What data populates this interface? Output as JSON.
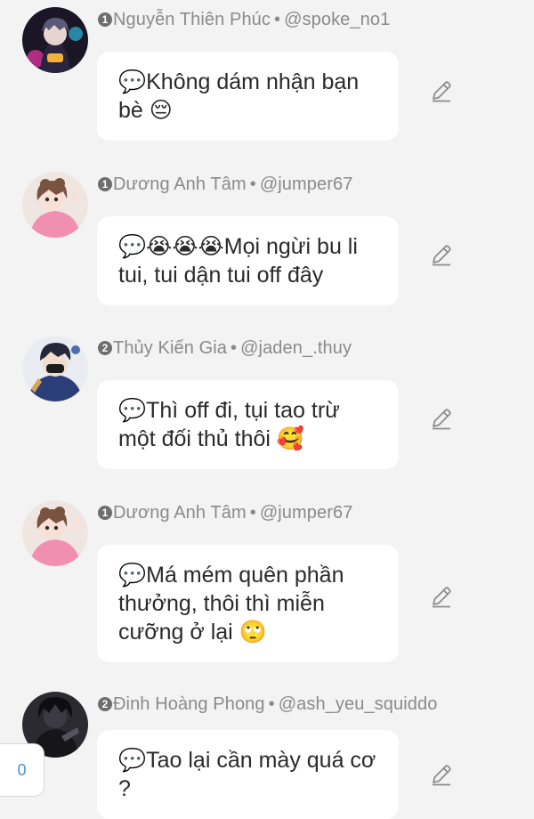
{
  "comments": [
    {
      "level": "1",
      "name": "Nguyễn Thiên Phúc",
      "separator": "•",
      "handle": "@spoke_no1",
      "text": "💬Không dám nhận bạn bè 😔",
      "avatar_icon": "dark-neon-anime-avatar"
    },
    {
      "level": "1",
      "name": "Dương Anh Tâm",
      "separator": "•",
      "handle": "@jumper67",
      "text": "💬😭😭😭Mọi ngừi bu li tui, tui dận tui off đây",
      "avatar_icon": "pink-anime-girl-avatar"
    },
    {
      "level": "2",
      "name": "Thủy Kiến Gia",
      "separator": "•",
      "handle": "@jaden_.thuy",
      "text": "💬Thì off đi, tụi tao trừ một đối thủ thôi 🥰",
      "avatar_icon": "masked-boy-avatar"
    },
    {
      "level": "1",
      "name": "Dương Anh Tâm",
      "separator": "•",
      "handle": "@jumper67",
      "text": "💬Má mém quên phần thưởng, thôi thì miễn cưỡng ở lại 🙄",
      "avatar_icon": "pink-anime-girl-avatar"
    },
    {
      "level": "2",
      "name": "Đinh Hoàng Phong",
      "separator": "•",
      "handle": "@ash_yeu_squiddo",
      "text": "💬Tao lại cần mày quá cơ ?",
      "avatar_icon": "dark-silhouette-avatar"
    }
  ],
  "floating_counter": {
    "value": "0"
  },
  "colors": {
    "background": "#f3f3f3",
    "bubble": "#ffffff",
    "meta_text": "#8a8a8a",
    "counter_text": "#4a90d9"
  }
}
